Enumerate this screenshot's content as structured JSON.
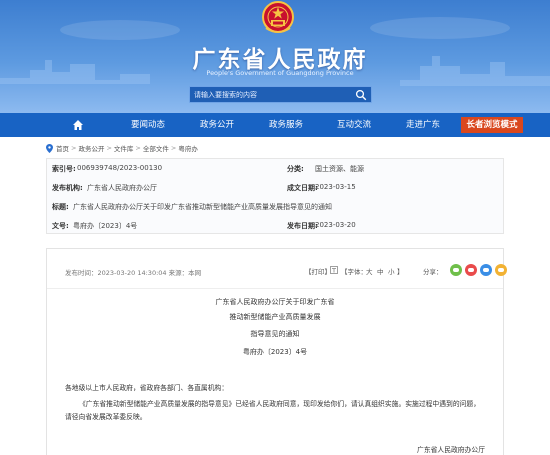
{
  "site": {
    "title": "广东省人民政府",
    "subtitle": "People's Government of Guangdong Province",
    "search_placeholder": "请输入要搜索的内容"
  },
  "nav": {
    "home_icon": "home-icon",
    "items": [
      "要闻动态",
      "政务公开",
      "政务服务",
      "互动交流",
      "走进广东"
    ],
    "senior_mode": "长者浏览模式"
  },
  "breadcrumb": {
    "icon": "location-pin-icon",
    "items": [
      "首页",
      "政务公开",
      "文件库",
      "全部文件",
      "粤府办"
    ]
  },
  "meta": {
    "index_label": "索引号:",
    "index_value": "006939748/2023-00130",
    "category_label": "分类:",
    "category_value": "国土资源、能源",
    "publisher_label": "发布机构:",
    "publisher_value": "广东省人民政府办公厅",
    "date_label": "成文日期:",
    "date_value": "2023-03-15",
    "title_label": "标题:",
    "title_value": "广东省人民政府办公厅关于印发广东省推动新型储能产业高质量发展指导意见的通知",
    "docno_label": "文号:",
    "docno_value": "粤府办〔2023〕4号",
    "pubdate_label": "发布日期:",
    "pubdate_value": "2023-03-20"
  },
  "article": {
    "info": "发布时间：2023-03-20 14:30:04    来源：本网",
    "print": "【打印】",
    "font_size_label": "【字体：",
    "font_big": "大",
    "font_mid": "中",
    "font_small": "小",
    "font_end": "】",
    "share_label": "分享：",
    "share_colors": [
      "#6fbf4a",
      "#e94b4b",
      "#3a8ee6",
      "#f2b233"
    ],
    "title_lines": [
      "广东省人民政府办公厅关于印发广东省",
      "推动新型储能产业高质量发展",
      "指导意见的通知",
      "粤府办〔2023〕4号"
    ],
    "salutation": "各地级以上市人民政府，省政府各部门、各直属机构：",
    "paragraph": "《广东省推动新型储能产业高质量发展的指导意见》已经省人民政府同意，现印发给你们，请认真组织实施。实施过程中遇到的问题，请径向省发展改革委反映。",
    "signature": "广东省人民政府办公厅"
  }
}
